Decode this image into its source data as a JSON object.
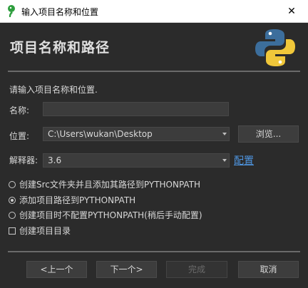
{
  "window": {
    "title": "输入项目名称和位置",
    "close_glyph": "✕"
  },
  "header": {
    "title": "项目名称和路径"
  },
  "hint": "请输入项目名称和位置.",
  "form": {
    "name_label": "名称:",
    "name_value": "",
    "location_label": "位置:",
    "location_value": "C:\\Users\\wukan\\Desktop",
    "browse_label": "浏览...",
    "interpreter_label": "解释器:",
    "interpreter_value": "3.6",
    "configure_link": "配置"
  },
  "options": [
    {
      "label": "创建Src文件夹并且添加其路径到PYTHONPATH",
      "type": "radio",
      "checked": false
    },
    {
      "label": "添加项目路径到PYTHONPATH",
      "type": "radio",
      "checked": true
    },
    {
      "label": "创建项目时不配置PYTHONPATH(稍后手动配置)",
      "type": "radio",
      "checked": false
    },
    {
      "label": "创建项目目录",
      "type": "checkbox",
      "checked": false
    }
  ],
  "footer": {
    "prev_label": "<上一个",
    "next_label": "下一个>",
    "finish_label": "完成",
    "cancel_label": "取消"
  },
  "colors": {
    "background": "#2b2b2b",
    "link": "#4e95e0",
    "python_blue": "#3c6e9c",
    "python_yellow": "#f0c73a"
  },
  "icons": [
    "python-leaf-icon",
    "close-icon",
    "python-logo",
    "dropdown-arrow-icon"
  ]
}
